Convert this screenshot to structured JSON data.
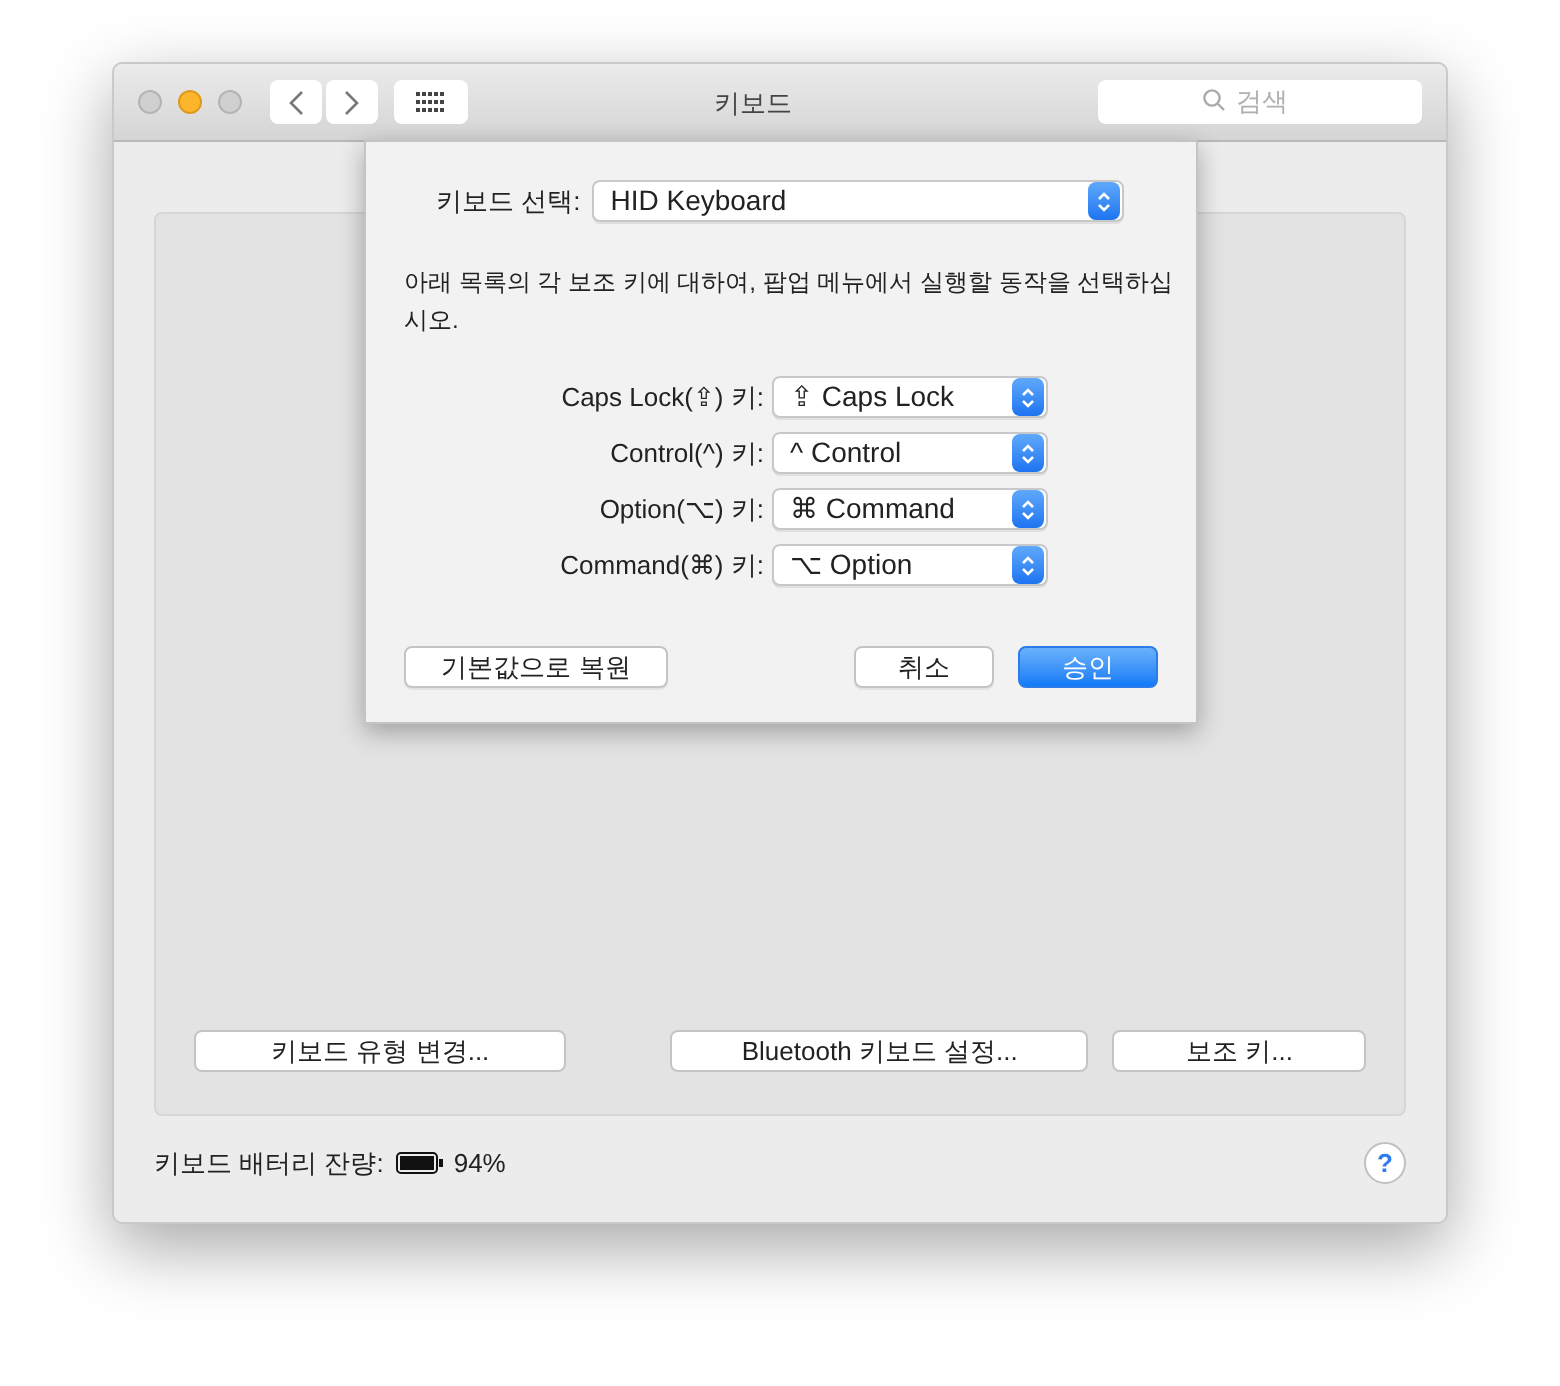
{
  "window": {
    "title": "키보드",
    "search": {
      "placeholder": "검색"
    }
  },
  "sheet": {
    "keyboard_select": {
      "label": "키보드 선택:",
      "value": "HID Keyboard"
    },
    "instruction": "아래 목록의 각 보조 키에 대하여,  팝업 메뉴에서 실행할 동작을 선택하십시오.",
    "modifiers": [
      {
        "label": "Caps Lock(⇪) 키:",
        "value": "⇪ Caps Lock"
      },
      {
        "label": "Control(^) 키:",
        "value": "^ Control"
      },
      {
        "label": "Option(⌥) 키:",
        "value": "⌘ Command"
      },
      {
        "label": "Command(⌘) 키:",
        "value": "⌥ Option"
      }
    ],
    "buttons": [
      {
        "label": "기본값으로 복원",
        "kind": "normal"
      },
      {
        "label": "취소",
        "kind": "normal"
      },
      {
        "label": "승인",
        "kind": "primary"
      }
    ]
  },
  "panel_buttons": [
    "키보드 유형 변경...",
    "Bluetooth 키보드 설정...",
    "보조 키..."
  ],
  "battery": {
    "label": "키보드 배터리 잔량:",
    "reading": "94%"
  },
  "help": "?"
}
